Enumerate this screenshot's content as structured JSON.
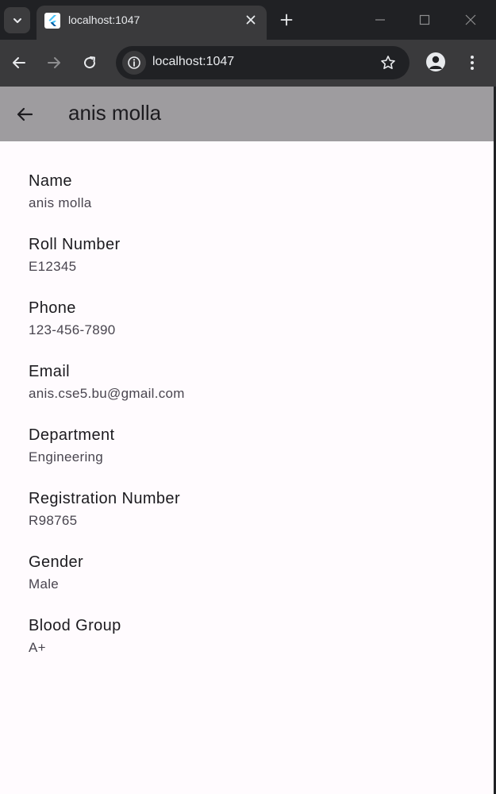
{
  "browser": {
    "tab_title": "localhost:1047",
    "url": "localhost:1047",
    "icons": {
      "tab_search": "chevron-down-icon",
      "favicon": "flutter-icon",
      "tab_close": "close-icon",
      "new_tab": "plus-icon",
      "back": "arrow-left-icon",
      "forward": "arrow-right-icon",
      "reload": "reload-icon",
      "site_info": "info-icon",
      "bookmark": "star-icon",
      "profile": "person-icon",
      "menu": "kebab-icon"
    }
  },
  "app": {
    "title": "anis molla",
    "appbar_color": "#9e9c9f",
    "background_color": "#fffbfe",
    "fields": [
      {
        "label": "Name",
        "value": "anis molla"
      },
      {
        "label": "Roll Number",
        "value": "E12345"
      },
      {
        "label": "Phone",
        "value": "123-456-7890"
      },
      {
        "label": "Email",
        "value": "anis.cse5.bu@gmail.com"
      },
      {
        "label": "Department",
        "value": "Engineering"
      },
      {
        "label": "Registration Number",
        "value": "R98765"
      },
      {
        "label": "Gender",
        "value": "Male"
      },
      {
        "label": "Blood Group",
        "value": "A+"
      }
    ]
  }
}
